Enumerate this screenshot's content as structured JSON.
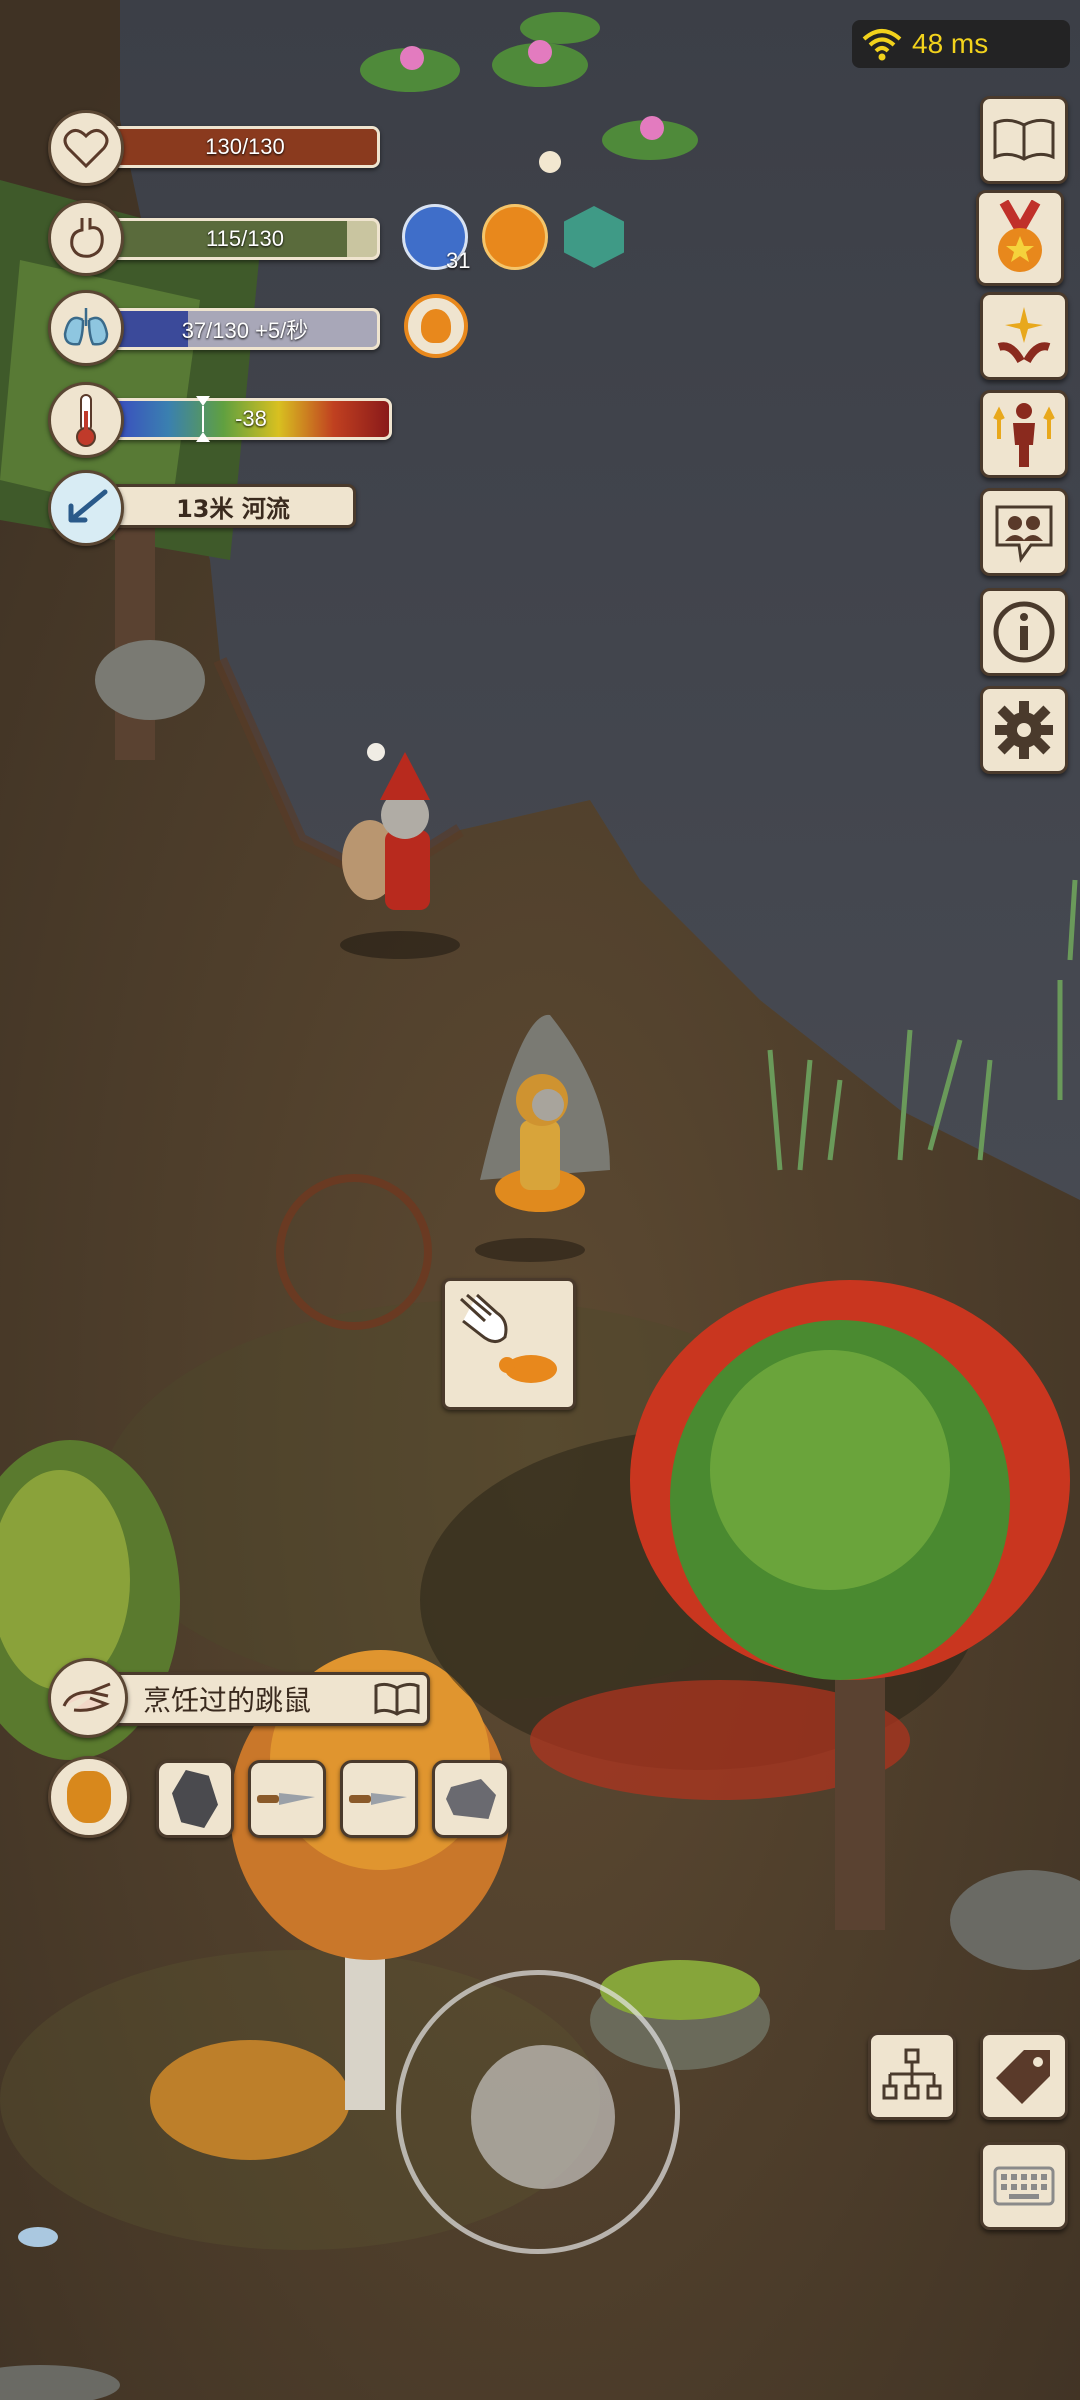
{
  "network": {
    "ping": "48 ms",
    "icon": "wifi-icon"
  },
  "stats": {
    "health": {
      "text": "130/130",
      "level": 1.0,
      "color": "#8a3a1e",
      "icon": "heart-icon"
    },
    "hunger": {
      "text": "115/130",
      "level": 0.885,
      "color": "#5a6b3c",
      "icon": "stomach-icon"
    },
    "oxygen": {
      "text": "37/130 +5/秒",
      "level": 0.285,
      "color": "#3b4a9a",
      "icon": "lungs-icon"
    },
    "temperature": {
      "text": "-38",
      "icon": "thermometer-icon"
    },
    "direction": {
      "text": "13米 河流",
      "icon": "compass-icon"
    }
  },
  "buffs": {
    "count": "31"
  },
  "held_item": {
    "label": "烹饪过的跳鼠",
    "icon": "hand-icon",
    "book_icon": "book-icon"
  },
  "side_menu": [
    "book-icon",
    "medal-icon",
    "skills-icon",
    "character-icon",
    "chat-icon",
    "info-icon",
    "gear-icon"
  ],
  "bottom_buttons": [
    "tech-tree-icon",
    "tag-icon",
    "keyboard-icon"
  ],
  "inventory": [
    "cooked-jerboa",
    "flint-stone",
    "knife",
    "knife",
    "stone"
  ],
  "colors": {
    "ui_panel": "#efe4cf",
    "ui_border": "#4a3a2c",
    "ping_text": "#f2d21c"
  }
}
